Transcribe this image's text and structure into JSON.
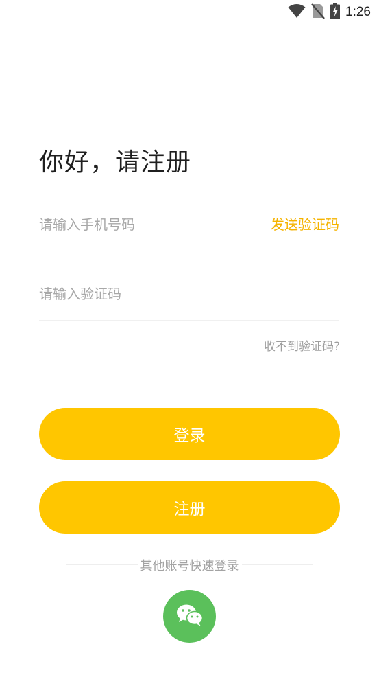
{
  "status_bar": {
    "time": "1:26",
    "icons": [
      "wifi-icon",
      "no-sim-icon",
      "battery-charging-icon"
    ]
  },
  "form": {
    "title": "你好，请注册",
    "phone_placeholder": "请输入手机号码",
    "send_code_label": "发送验证码",
    "code_placeholder": "请输入验证码",
    "no_code_link": "收不到验证码?"
  },
  "buttons": {
    "login_label": "登录",
    "register_label": "注册"
  },
  "other_login": {
    "label": "其他账号快速登录",
    "icons": [
      "wechat-icon"
    ]
  },
  "colors": {
    "accent": "#ffc600",
    "send_code_text": "#f5b300",
    "wechat_green": "#5bc05b"
  }
}
